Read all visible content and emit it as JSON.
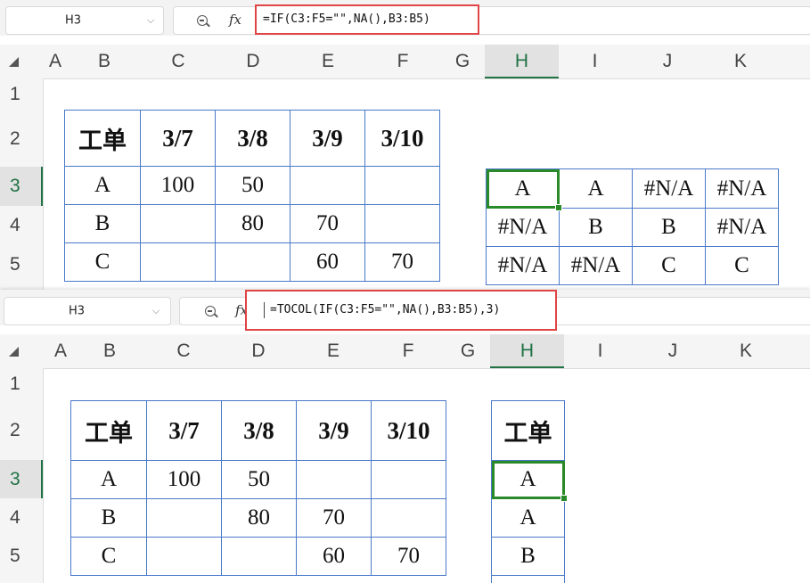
{
  "top_window": {
    "name_box": "H3",
    "formula": "=IF(C3:F5=\"\",NA(),B3:B5)",
    "columns": [
      "A",
      "B",
      "C",
      "D",
      "E",
      "F",
      "G",
      "H",
      "I",
      "J",
      "K"
    ],
    "selected_column": "H",
    "rows": [
      "1",
      "2",
      "3",
      "4",
      "5"
    ],
    "selected_row": "3",
    "source_table": [
      [
        "工单",
        "3/7",
        "3/8",
        "3/9",
        "3/10"
      ],
      [
        "A",
        "100",
        "50",
        "",
        ""
      ],
      [
        "B",
        "",
        "80",
        "70",
        ""
      ],
      [
        "C",
        "",
        "",
        "60",
        "70"
      ]
    ],
    "result_table": [
      [
        "A",
        "A",
        "#N/A",
        "#N/A"
      ],
      [
        "#N/A",
        "B",
        "B",
        "#N/A"
      ],
      [
        "#N/A",
        "#N/A",
        "C",
        "C"
      ]
    ]
  },
  "bottom_window": {
    "name_box": "H3",
    "formula": "=TOCOL(IF(C3:F5=\"\",NA(),B3:B5),3)",
    "columns": [
      "A",
      "B",
      "C",
      "D",
      "E",
      "F",
      "G",
      "H",
      "I",
      "J",
      "K"
    ],
    "selected_column": "H",
    "rows": [
      "1",
      "2",
      "3",
      "4",
      "5"
    ],
    "selected_row": "3",
    "source_table": [
      [
        "工单",
        "3/7",
        "3/8",
        "3/9",
        "3/10"
      ],
      [
        "A",
        "100",
        "50",
        "",
        ""
      ],
      [
        "B",
        "",
        "80",
        "70",
        ""
      ],
      [
        "C",
        "",
        "",
        "60",
        "70"
      ]
    ],
    "result_column": [
      "工单",
      "A",
      "A",
      "B"
    ]
  },
  "icons": {
    "dropdown": "chevron-down-icon",
    "zoom": "zoom-icon",
    "function": "fx-icon",
    "select_all": "select-all-corner-icon"
  },
  "glyphs": {
    "fx": "fx",
    "chevron": "⌵"
  },
  "colors": {
    "formula_highlight": "#e04545",
    "active_cell": "#2a8a2a",
    "table_border": "#4a79c9"
  }
}
